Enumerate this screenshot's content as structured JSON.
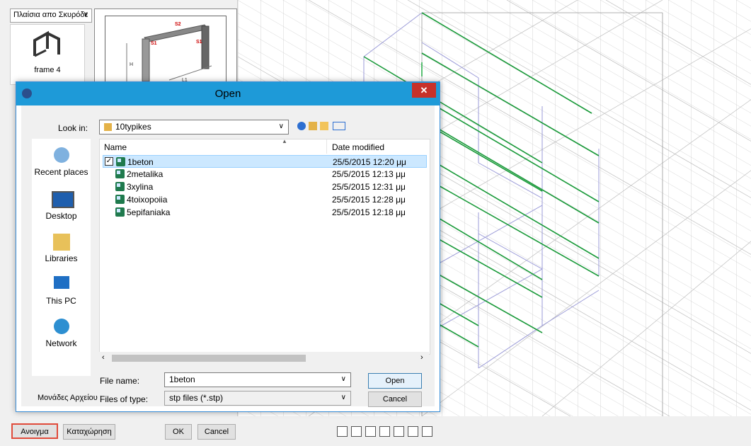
{
  "left_panel": {
    "category_select": "Πλαίσια απο Σκυρόδε",
    "thumbnail_label": "frame 4",
    "preview_labels": [
      "S2",
      "S1",
      "S1",
      "H",
      "L1"
    ]
  },
  "dialog": {
    "title": "Open",
    "close_label": "✕",
    "look_in_label": "Look in:",
    "look_in_value": "10typikes",
    "places": [
      "Recent places",
      "Desktop",
      "Libraries",
      "This PC",
      "Network"
    ],
    "columns": {
      "name": "Name",
      "date": "Date modified"
    },
    "files": [
      {
        "name": "1beton",
        "date": "25/5/2015 12:20 μμ",
        "selected": true
      },
      {
        "name": "2metalika",
        "date": "25/5/2015 12:13 μμ",
        "selected": false
      },
      {
        "name": "3xylina",
        "date": "25/5/2015 12:31 μμ",
        "selected": false
      },
      {
        "name": "4toixopoiia",
        "date": "25/5/2015 12:28 μμ",
        "selected": false
      },
      {
        "name": "5epifaniaka",
        "date": "25/5/2015 12:18 μμ",
        "selected": false
      }
    ],
    "file_name_label": "File name:",
    "file_name_value": "1beton",
    "file_type_label": "Files of type:",
    "file_type_value": "stp files (*.stp)",
    "open_button": "Open",
    "cancel_button": "Cancel",
    "units_label": "Μονάδες Αρχείου :"
  },
  "bottom_bar": {
    "open_button": "Ανοιγμα",
    "save_button": "Καταχώρηση",
    "ok_button": "OK",
    "cancel_button": "Cancel",
    "view_buttons": [
      "iso-view-1",
      "iso-view-2",
      "iso-view-3",
      "view-4",
      "view-5",
      "view-6",
      "view-7"
    ]
  },
  "colors": {
    "title_bar": "#1e9ad8",
    "close": "#c7312a",
    "selection": "#cce8ff",
    "highlight": "#e04a3a"
  }
}
